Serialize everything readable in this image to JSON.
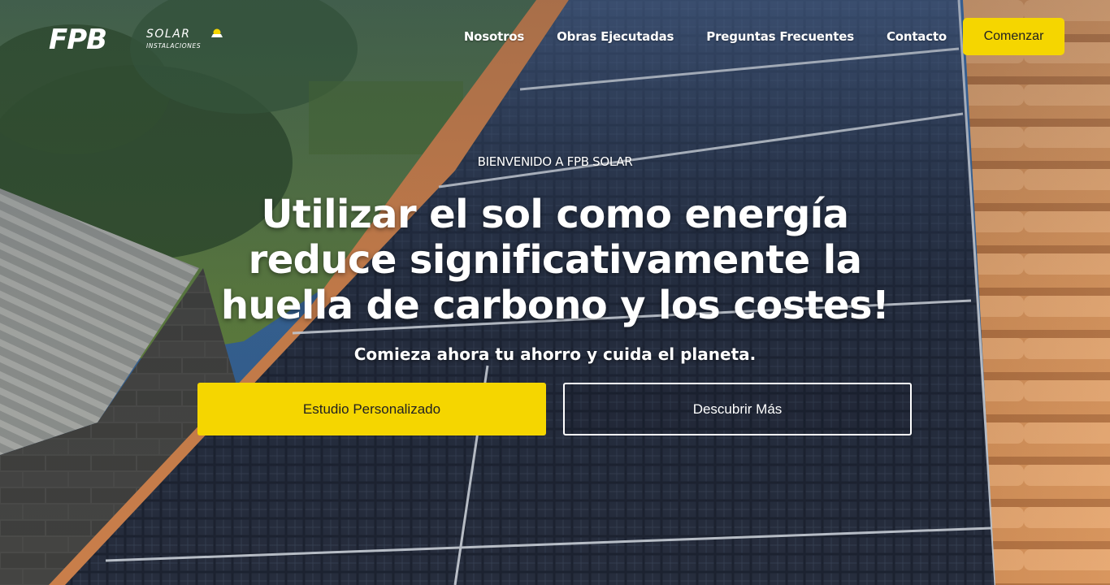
{
  "brand": {
    "logo_letters": "FPB",
    "logo_word": "SOLAR",
    "logo_tag": "INSTALACIONES",
    "logo_icon": "sun-icon"
  },
  "nav": {
    "items": [
      {
        "label": "Nosotros"
      },
      {
        "label": "Obras Ejecutadas"
      },
      {
        "label": "Preguntas Frecuentes"
      },
      {
        "label": "Contacto"
      }
    ],
    "cta_label": "Comenzar"
  },
  "hero": {
    "eyebrow": "BIENVENIDO A FPB SOLAR",
    "headline": "Utilizar el sol como energía reduce significativamente la huella de carbono y los costes!",
    "subhead": "Comieza ahora tu ahorro y cuida el planeta.",
    "primary_button": "Estudio Personalizado",
    "secondary_button": "Descubrir Más"
  },
  "colors": {
    "accent": "#f5d600",
    "text_light": "#ffffff",
    "text_dark": "#222222"
  }
}
